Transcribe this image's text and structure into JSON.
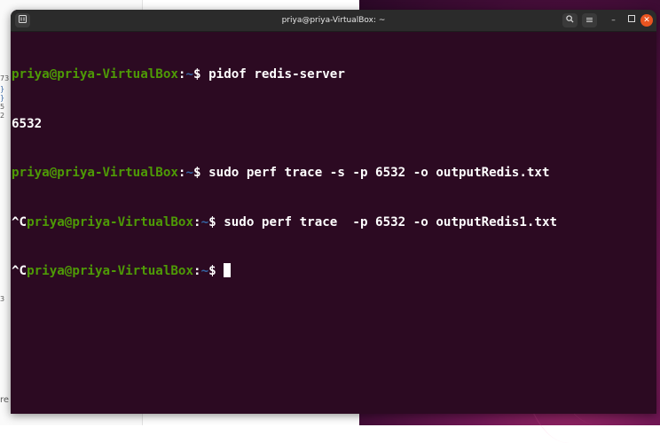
{
  "window": {
    "title": "priya@priya-VirtualBox: ~"
  },
  "prompt": {
    "user_host": "priya@priya-VirtualBox",
    "colon": ":",
    "path": "~",
    "symbol": "$ ",
    "interrupt": "^C"
  },
  "lines": {
    "l1": {
      "cmd": "pidof redis-server"
    },
    "l2": {
      "output": "6532"
    },
    "l3": {
      "cmd": "sudo perf trace -s -p 6532 -o outputRedis.txt"
    },
    "l4": {
      "cmd": "sudo perf trace  -p 6532 -o outputRedis1.txt"
    }
  },
  "background_app": {
    "fragments": [
      "73",
      "}",
      "}",
      "5",
      "2",
      "3",
      "re"
    ]
  },
  "colors": {
    "terminal_bg": "#2c0a22",
    "prompt_user": "#4e9a06",
    "prompt_path": "#3465a4",
    "titlebar_bg": "#2b2b2b",
    "close_button": "#e95420"
  },
  "icons": {
    "new_tab": "new-tab-icon",
    "search": "search-icon",
    "menu": "hamburger-menu-icon",
    "minimize": "minimize-icon",
    "maximize": "maximize-icon",
    "close": "close-icon"
  }
}
